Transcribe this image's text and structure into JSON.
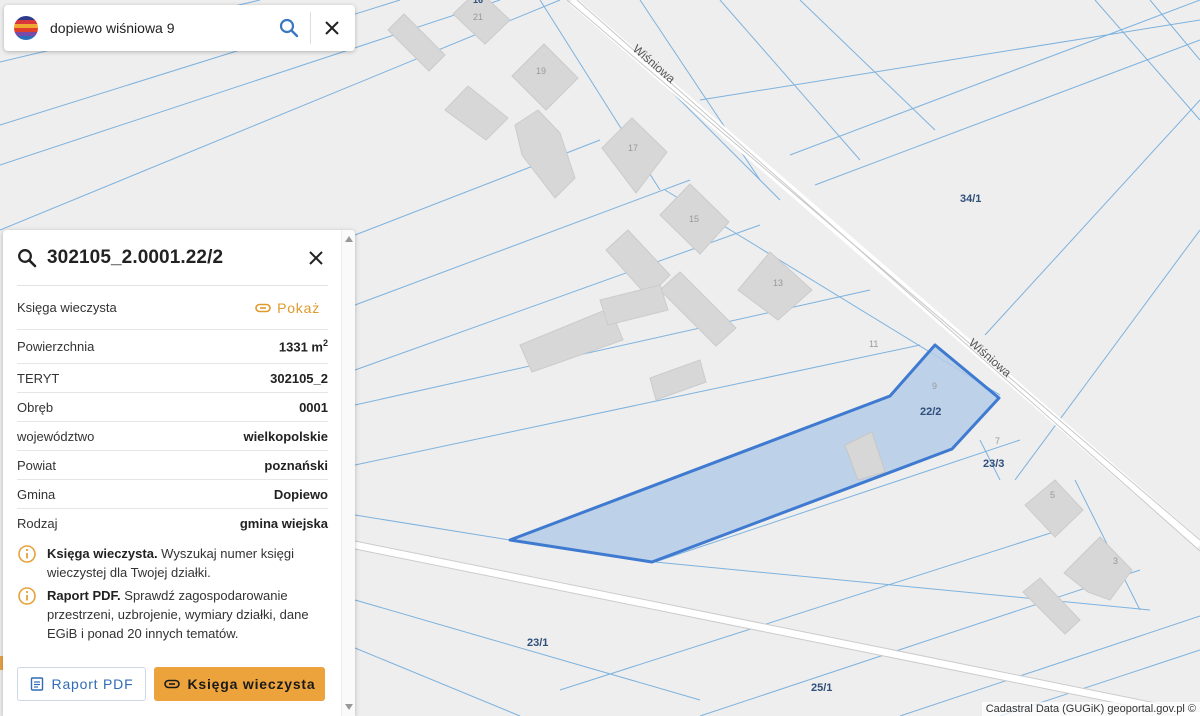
{
  "search": {
    "query": "dopiewo wiśniowa 9"
  },
  "map": {
    "streets": [
      "Wiśniowa",
      "Wiśniowa"
    ],
    "house_numbers": [
      "16",
      "21",
      "19",
      "17",
      "15",
      "13",
      "11",
      "9",
      "7",
      "5",
      "3"
    ],
    "parcels": [
      "34/1",
      "22/2",
      "23/3",
      "23/1",
      "25/1"
    ],
    "attribution": "Cadastral Data (GUGiK) geoportal.gov.pl ©"
  },
  "panel": {
    "title": "302105_2.0001.22/2",
    "ksiega": {
      "label": "Księga wieczysta",
      "action": "Pokaż"
    },
    "area": {
      "label": "Powierzchnia",
      "value": "1331 m",
      "unit_sup": "2"
    },
    "rows": [
      {
        "label": "TERYT",
        "value": "302105_2"
      },
      {
        "label": "Obręb",
        "value": "0001"
      },
      {
        "label": "województwo",
        "value": "wielkopolskie"
      },
      {
        "label": "Powiat",
        "value": "poznański"
      },
      {
        "label": "Gmina",
        "value": "Dopiewo"
      },
      {
        "label": "Rodzaj",
        "value": "gmina wiejska"
      }
    ],
    "info": [
      {
        "bold": "Księga wieczysta.",
        "text": " Wyszukaj numer księgi wieczystej dla Twojej działki."
      },
      {
        "bold": "Raport PDF.",
        "text": " Sprawdź zagospodarowanie przestrzeni, uzbrojenie, wymiary działki, dane EGiB i ponad 20 innych tematów."
      }
    ],
    "buttons": {
      "pdf": "Raport PDF",
      "kw": "Księga wieczysta"
    }
  },
  "colors": {
    "parcel_line": "#7db2de",
    "selection_fill": "#b4cbe8",
    "selection_stroke": "#3f7ad1",
    "building": "#d7d7d7",
    "accent": "#eda33c"
  }
}
